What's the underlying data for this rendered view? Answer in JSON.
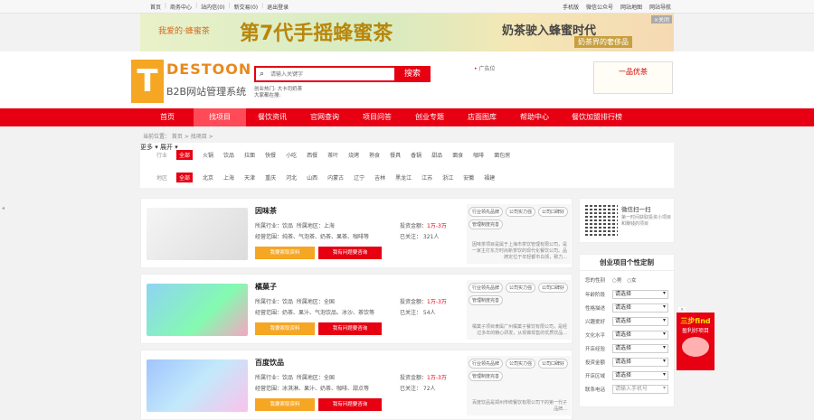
{
  "topbar": {
    "left": [
      "首页",
      "商务中心",
      "站内信(0)",
      "新交易(0)",
      "退出登录"
    ],
    "right": [
      "手机版",
      "微信公众号",
      "网站地图",
      "网站导航"
    ]
  },
  "banner": {
    "tagline": "我爱的·蜂蜜茶",
    "headline": "第7代手摇蜂蜜茶",
    "slogan": "奶茶驶入蜂蜜时代",
    "badge": "奶茶界的奢侈品",
    "close": "×关闭"
  },
  "header": {
    "logo_letter": "T",
    "logo_name": "DESTOON",
    "logo_sub": "B2B网站管理系统",
    "search_placeholder": "请输入关键字",
    "search_button": "搜索",
    "hot_words": "创业热门:   大卡司奶茶",
    "searching": "大家都在搜:",
    "ad_label": "广告位",
    "ad_brand": "一品优茶"
  },
  "nav": {
    "items": [
      "首页",
      "找项目",
      "餐饮资讯",
      "官网查询",
      "项目问答",
      "创业专题",
      "店面图库",
      "帮助中心",
      "餐饮加盟排行榜"
    ],
    "active_index": 1
  },
  "breadcrumb": "当前位置：  首页 >  找项目 >",
  "filters": {
    "industry_label": "行业",
    "industry_all": "全部",
    "industry": [
      "火锅",
      "饮品",
      "拉面",
      "快餐",
      "小吃",
      "西餐",
      "茶叶",
      "烧烤",
      "熟食",
      "餐具",
      "香锅",
      "甜品",
      "面食",
      "咖啡",
      "面包房"
    ],
    "more": "更多",
    "region_label": "地区",
    "region_all": "全部",
    "regions": [
      "北京",
      "上海",
      "天津",
      "重庆",
      "河北",
      "山西",
      "内蒙古",
      "辽宁",
      "吉林",
      "黑龙江",
      "江苏",
      "浙江",
      "安徽",
      "福建"
    ],
    "expand": "展开"
  },
  "items": [
    {
      "name": "因味茶",
      "industry": "所属行业：饮品",
      "region": "所属地区：上海",
      "scope": "经营范围：纯茶、气泡茶、奶茶、果茶、咖啡等",
      "invest_label": "投资金额：",
      "invest": "1万-3万",
      "follow": "已关注：  321人",
      "btn1": "我要索取资料",
      "btn2": "我有问题要咨询",
      "tags": [
        "行业领先品牌",
        "公司实力强",
        "公司口碑好",
        "管理制度完善"
      ],
      "desc": "因味茶项目是属于上海市茶饮管理有限公司，是一家主打东方时尚新茶饮的现代化餐饮公司。品牌定位于年轻都市白领，致力..."
    },
    {
      "name": "橘菓子",
      "industry": "所属行业：饮品",
      "region": "所属地区：全国",
      "scope": "经营范围：奶茶、果汁、气泡饮品、冰沙、茶饮等",
      "invest_label": "投资金额：",
      "invest": "1万-3万",
      "follow": "已关注：  54人",
      "btn1": "我要索取资料",
      "btn2": "我有问题要咨询",
      "tags": [
        "行业领先品牌",
        "公司实力强",
        "公司口碑好",
        "管理制度完善"
      ],
      "desc": "橘菓子项目隶属广州橘菓子餐饮有限公司，是经过多年的精心研发，从现做现售的优质饮品..."
    },
    {
      "name": "百度饮品",
      "industry": "所属行业：饮品",
      "region": "所属地区：全国",
      "scope": "经营范围：冰淇淋、果汁、奶茶、咖啡、甜点等",
      "invest_label": "投资金额：",
      "invest": "1万-3万",
      "follow": "已关注：  72人",
      "btn1": "我要索取资料",
      "btn2": "我有问题要咨询",
      "tags": [
        "行业领先品牌",
        "公司实力强",
        "公司口碑好",
        "管理制度完善"
      ],
      "desc": "百度饮品是郑州传统餐饮有限公司下的第一代子品牌..."
    }
  ],
  "sidebar": {
    "qr_title": "微信扫一扫",
    "qr_desc": "第一时间获取投资小项目和赚钱的项目",
    "custom_title": "创业项目个性定制",
    "rows": [
      {
        "label": "您的性别",
        "type": "radio",
        "options": [
          "男",
          "女"
        ]
      },
      {
        "label": "年龄阶段",
        "value": "请选择"
      },
      {
        "label": "性格描述",
        "value": "请选择"
      },
      {
        "label": "兴趣爱好",
        "value": "请选择"
      },
      {
        "label": "文化水平",
        "value": "请选择"
      },
      {
        "label": "开店经验",
        "value": "请选择"
      },
      {
        "label": "投资金额",
        "value": "请选择"
      },
      {
        "label": "开店区域",
        "value": "请选择"
      },
      {
        "label": "联系电话",
        "value": "请输入手机号"
      }
    ]
  },
  "float_ad": {
    "line1": "三步find",
    "line2": "盈利好项目",
    "close": "×"
  },
  "colors": {
    "brand_red": "#e60012",
    "orange": "#f5a623"
  }
}
